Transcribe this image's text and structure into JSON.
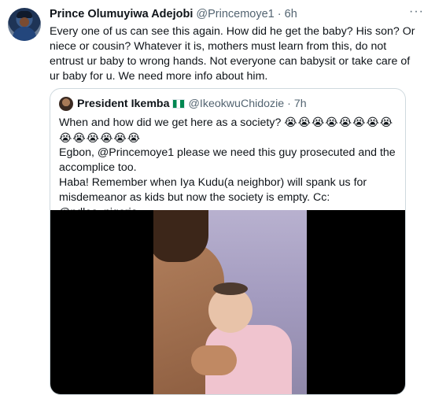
{
  "tweet": {
    "author_name": "Prince Olumuyiwa Adejobi",
    "author_handle": "@Princemoye1",
    "separator": "·",
    "time": "6h",
    "more_icon": "more-horizontal-icon",
    "text": "Every one of us can see this again. How did he get the baby? His son? Or niece or cousin? Whatever it is, mothers must learn from this, do not entrust ur baby to wrong hands. Not everyone can babysit or take care of ur baby for u. We need more info about him."
  },
  "quote": {
    "author_name": "President Ikemba",
    "flag_icon": "nigeria-flag-icon",
    "author_handle": "@IkeokwuChidozie",
    "separator": "·",
    "time": "7h",
    "line1": "When and how did we get here as a society?",
    "emoji_row1": "😭😭😭😭😭😭😭😭",
    "emoji_row2": "😭😭😭😭😭😭",
    "line2": "Egbon, @Princemoye1 please we need this guy prosecuted and the accomplice too.",
    "line3": "Haba! Remember when Iya Kudu(a neighbor) will spank us for misdemeanor as kids but now the society is empty. Cc: @ndlea_nigeria"
  }
}
